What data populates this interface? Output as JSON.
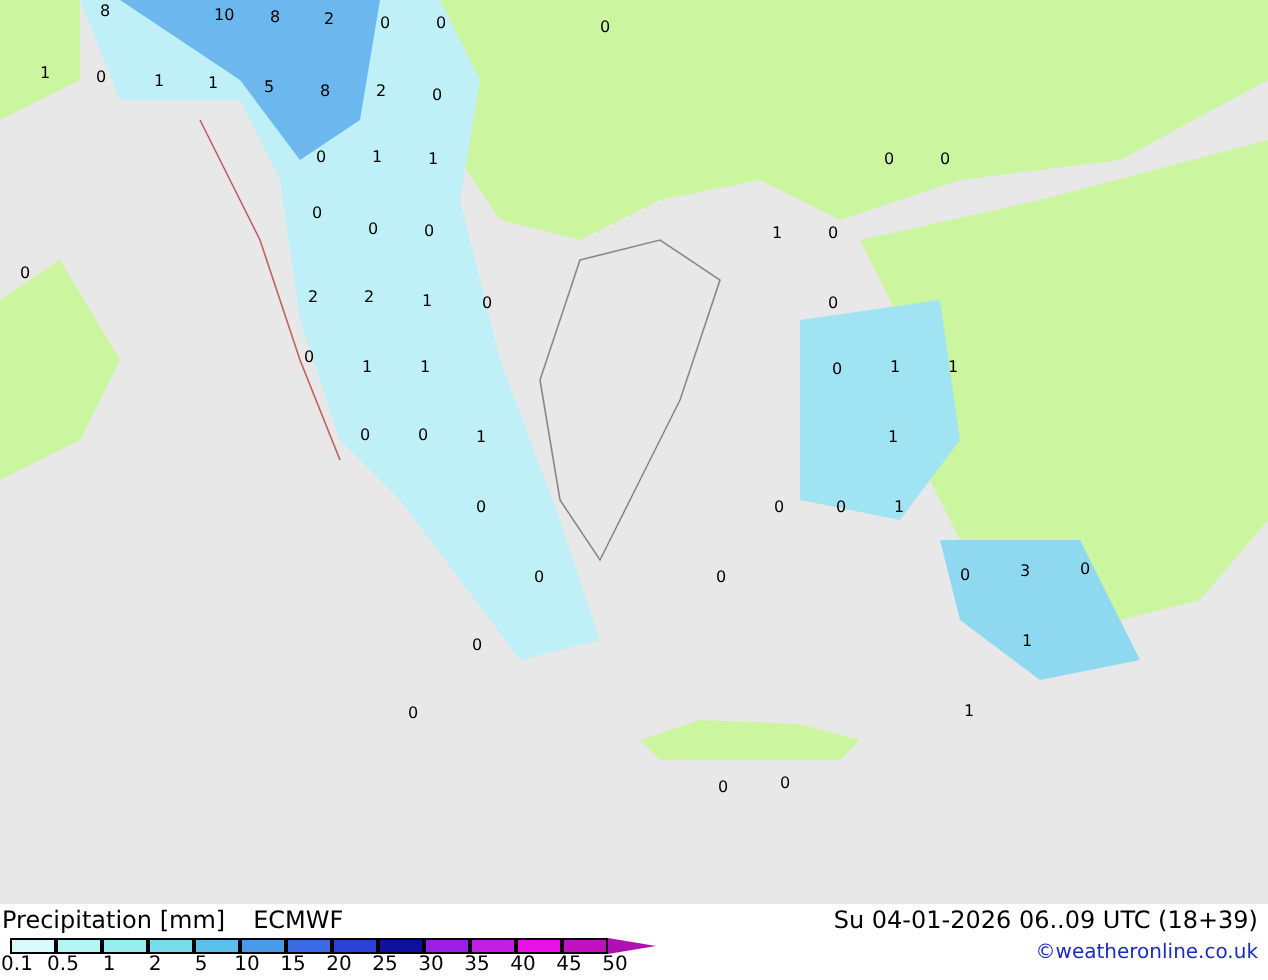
{
  "map": {
    "labels": [
      "8",
      "10",
      "8",
      "2",
      "0",
      "0",
      "0",
      "1",
      "0",
      "1",
      "1",
      "5",
      "8",
      "2",
      "0",
      "0",
      "1",
      "1",
      "0",
      "0",
      "0",
      "0",
      "0",
      "1",
      "0",
      "0",
      "2",
      "2",
      "1",
      "0",
      "0",
      "0",
      "1",
      "1",
      "0",
      "1",
      "1",
      "0",
      "0",
      "1",
      "1",
      "0",
      "0",
      "0",
      "1",
      "0",
      "0",
      "0",
      "3",
      "0",
      "0",
      "1",
      "0",
      "1",
      "0",
      "0"
    ]
  },
  "title": "Precipitation [mm]",
  "model": "ECMWF",
  "valid_time": "Su 04-01-2026 06..09 UTC (18+39)",
  "credit": "©weatheronline.co.uk",
  "legend": {
    "segments": [
      {
        "color": "#d8fafa"
      },
      {
        "color": "#b4f4f4"
      },
      {
        "color": "#96eef0"
      },
      {
        "color": "#78dcec"
      },
      {
        "color": "#5ac0ec"
      },
      {
        "color": "#4a9aea"
      },
      {
        "color": "#3a6ae6"
      },
      {
        "color": "#2a40d6"
      },
      {
        "color": "#1010a0"
      },
      {
        "color": "#9a1ee6"
      },
      {
        "color": "#c41ee6"
      },
      {
        "color": "#ea10ea"
      },
      {
        "color": "#c010c0"
      }
    ],
    "ticks": [
      "0.1",
      "0.5",
      "1",
      "2",
      "5",
      "10",
      "15",
      "20",
      "25",
      "30",
      "35",
      "40",
      "45",
      "50"
    ]
  }
}
